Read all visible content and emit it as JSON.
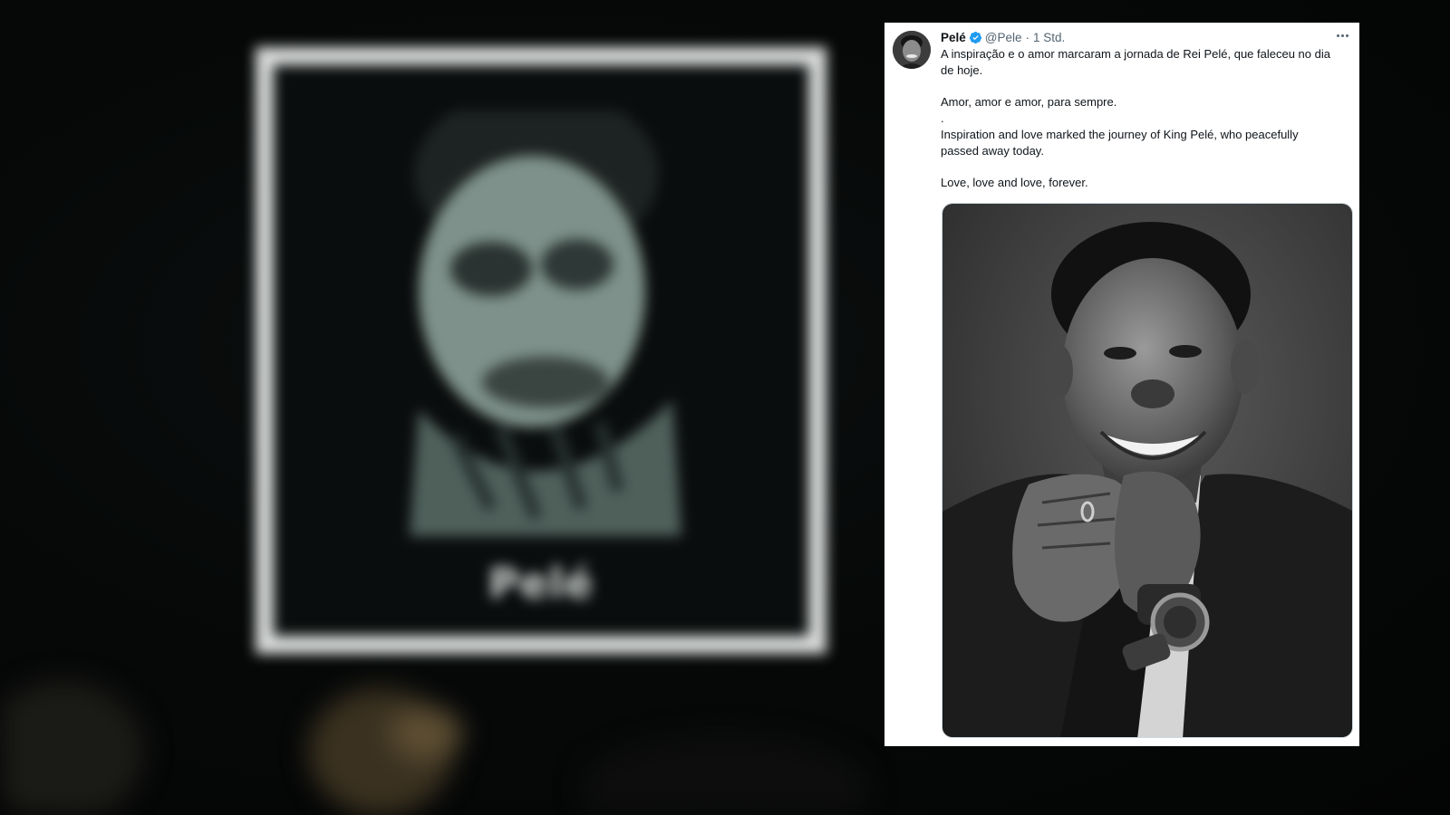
{
  "tweet": {
    "display_name": "Pelé",
    "handle": "@Pele",
    "separator": "·",
    "time": "1 Std.",
    "verified_icon": "verified-badge-icon",
    "more_icon": "more-options-icon",
    "text": {
      "line1": "A inspiração e o amor marcaram a jornada de Rei Pelé, que faleceu no dia de hoje.",
      "line2": "Amor, amor e amor, para sempre.",
      "line3": ".",
      "line4": "Inspiration and love marked the journey of King Pelé, who peacefully passed away today.",
      "line5": "Love, love and love, forever."
    },
    "media": {
      "type": "black-and-white portrait photo"
    },
    "colors": {
      "verified": "#1d9bf0",
      "text": "#0f1419",
      "secondary": "#536471"
    }
  },
  "background": {
    "screen_name": "Pelé"
  }
}
